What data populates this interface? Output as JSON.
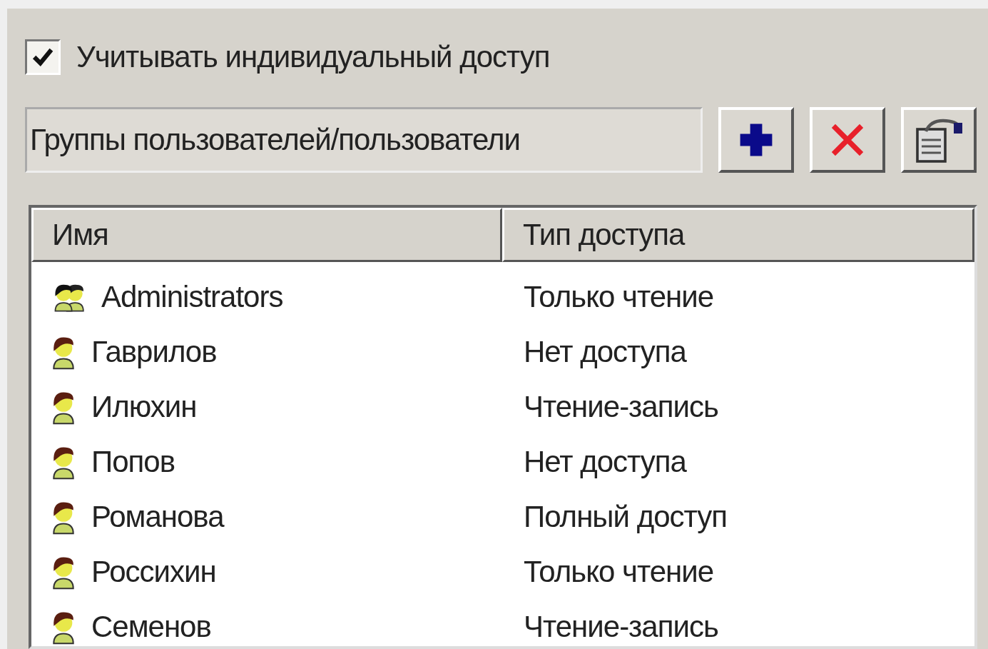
{
  "individual_access": {
    "label": "Учитывать индивидуальный доступ",
    "checked": true
  },
  "group_field": {
    "value": "Группы пользователей/пользователи"
  },
  "toolbar": [
    {
      "kind": "add"
    },
    {
      "kind": "delete"
    },
    {
      "kind": "properties"
    }
  ],
  "table": {
    "columns": [
      "Имя",
      "Тип доступа"
    ],
    "rows": [
      {
        "kind": "group",
        "name": "Administrators",
        "access": "Только чтение"
      },
      {
        "kind": "user",
        "name": "Гаврилов",
        "access": "Нет доступа"
      },
      {
        "kind": "user",
        "name": "Илюхин",
        "access": "Чтение-запись"
      },
      {
        "kind": "user",
        "name": "Попов",
        "access": "Нет доступа"
      },
      {
        "kind": "user",
        "name": "Романова",
        "access": "Полный доступ"
      },
      {
        "kind": "user",
        "name": "Россихин",
        "access": "Только чтение"
      },
      {
        "kind": "user",
        "name": "Семенов",
        "access": "Чтение-запись"
      }
    ]
  }
}
